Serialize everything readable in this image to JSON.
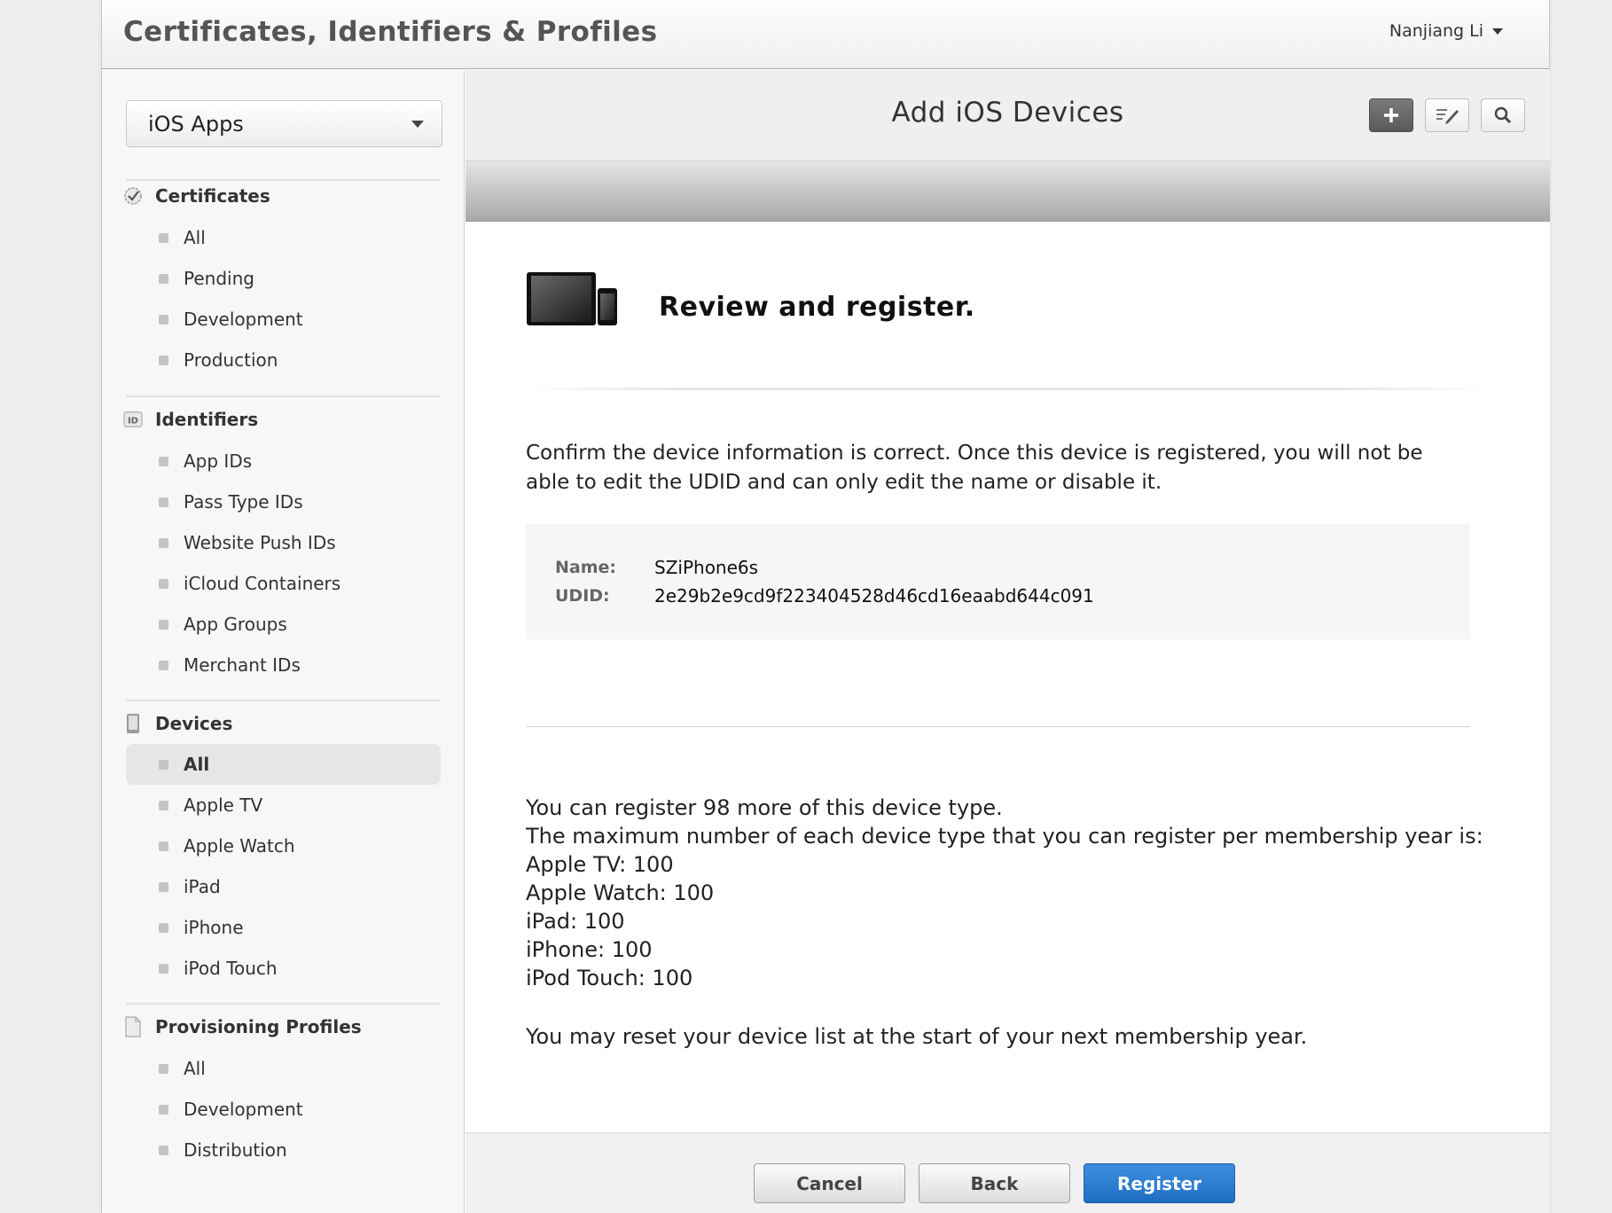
{
  "header": {
    "title": "Certificates, Identifiers & Profiles",
    "user_name": "Nanjiang Li"
  },
  "sidebar": {
    "platform": "iOS Apps",
    "sections": [
      {
        "title": "Certificates",
        "items": [
          "All",
          "Pending",
          "Development",
          "Production"
        ]
      },
      {
        "title": "Identifiers",
        "items": [
          "App IDs",
          "Pass Type IDs",
          "Website Push IDs",
          "iCloud Containers",
          "App Groups",
          "Merchant IDs"
        ]
      },
      {
        "title": "Devices",
        "items": [
          "All",
          "Apple TV",
          "Apple Watch",
          "iPad",
          "iPhone",
          "iPod Touch"
        ],
        "active": "All"
      },
      {
        "title": "Provisioning Profiles",
        "items": [
          "All",
          "Development",
          "Distribution"
        ]
      }
    ],
    "id_badge": "ID"
  },
  "main": {
    "title": "Add iOS Devices",
    "step_heading": "Review and register.",
    "confirm_text": "Confirm the device information is correct. Once this device is registered, you will not be able to edit the UDID and can only edit the name or disable it.",
    "device": {
      "name_label": "Name:",
      "name": "SZiPhone6s",
      "udid_label": "UDID:",
      "udid": "2e29b2e9cd9f223404528d46cd16eaabd644c091"
    },
    "limits": {
      "remaining": "You can register 98 more of this device type.",
      "max_intro": "The maximum number of each device type that you can register per membership year is:",
      "lines": [
        "Apple TV: 100",
        "Apple Watch: 100",
        "iPad: 100",
        "iPhone: 100",
        "iPod Touch: 100"
      ],
      "reset_note": "You may reset your device list at the start of your next membership year."
    }
  },
  "footer": {
    "cancel": "Cancel",
    "back": "Back",
    "register": "Register"
  },
  "colors": {
    "primary_button": "#2a7ad0",
    "active_item_bg": "#e6e6e6"
  }
}
